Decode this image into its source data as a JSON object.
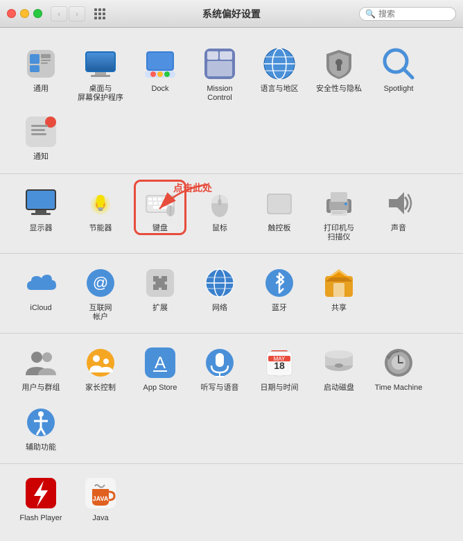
{
  "titlebar": {
    "title": "系统偏好设置",
    "search_placeholder": "搜索"
  },
  "sections": [
    {
      "id": "section1",
      "items": [
        {
          "id": "general",
          "label": "通用",
          "color": "#5b9bd5"
        },
        {
          "id": "desktop",
          "label": "桌面与\n屏幕保护程序",
          "color": "#4a90d9"
        },
        {
          "id": "dock",
          "label": "Dock",
          "color": "#4a90d9"
        },
        {
          "id": "mission",
          "label": "Mission\nControl",
          "color": "#6c8ebf"
        },
        {
          "id": "language",
          "label": "语言与地区",
          "color": "#4a90d9"
        },
        {
          "id": "security",
          "label": "安全性与隐私",
          "color": "#7c7c7c"
        },
        {
          "id": "spotlight",
          "label": "Spotlight",
          "color": "#4a90d9"
        },
        {
          "id": "notification",
          "label": "通知",
          "color": "#999"
        }
      ]
    },
    {
      "id": "section2",
      "items": [
        {
          "id": "display",
          "label": "显示器",
          "color": "#4a90d9"
        },
        {
          "id": "energy",
          "label": "节能器",
          "color": "#f5a623"
        },
        {
          "id": "keyboard",
          "label": "键盘",
          "color": "#7c7c7c",
          "highlight": true
        },
        {
          "id": "mouse",
          "label": "鼠标",
          "color": "#7c7c7c"
        },
        {
          "id": "trackpad",
          "label": "触控板",
          "color": "#7c7c7c"
        },
        {
          "id": "printer",
          "label": "打印机与\n扫描仪",
          "color": "#7c7c7c"
        },
        {
          "id": "sound",
          "label": "声音",
          "color": "#7c7c7c"
        }
      ]
    },
    {
      "id": "section3",
      "items": [
        {
          "id": "icloud",
          "label": "iCloud",
          "color": "#4a90d9"
        },
        {
          "id": "internet",
          "label": "互联网\n帐户",
          "color": "#4a90d9"
        },
        {
          "id": "extensions",
          "label": "扩展",
          "color": "#888"
        },
        {
          "id": "network",
          "label": "网络",
          "color": "#4a90d9"
        },
        {
          "id": "bluetooth",
          "label": "蓝牙",
          "color": "#4a90d9"
        },
        {
          "id": "sharing",
          "label": "共享",
          "color": "#e8a020"
        }
      ]
    },
    {
      "id": "section4",
      "items": [
        {
          "id": "users",
          "label": "用户与群组",
          "color": "#7c7c7c"
        },
        {
          "id": "parental",
          "label": "家长控制",
          "color": "#f5a623"
        },
        {
          "id": "appstore",
          "label": "App Store",
          "color": "#4a90d9"
        },
        {
          "id": "dictation",
          "label": "听写与语音",
          "color": "#4a90d9"
        },
        {
          "id": "datetime",
          "label": "日期与时间",
          "color": "#4a90d9"
        },
        {
          "id": "startup",
          "label": "启动磁盘",
          "color": "#7c7c7c"
        },
        {
          "id": "timemachine",
          "label": "Time Machine",
          "color": "#7c7c7c"
        },
        {
          "id": "accessibility",
          "label": "辅助功能",
          "color": "#4a90d9"
        }
      ]
    },
    {
      "id": "section5",
      "items": [
        {
          "id": "flash",
          "label": "Flash Player",
          "color": "#cc0000"
        },
        {
          "id": "java",
          "label": "Java",
          "color": "#e06020"
        }
      ]
    }
  ],
  "annotation": {
    "text": "点击此处"
  }
}
